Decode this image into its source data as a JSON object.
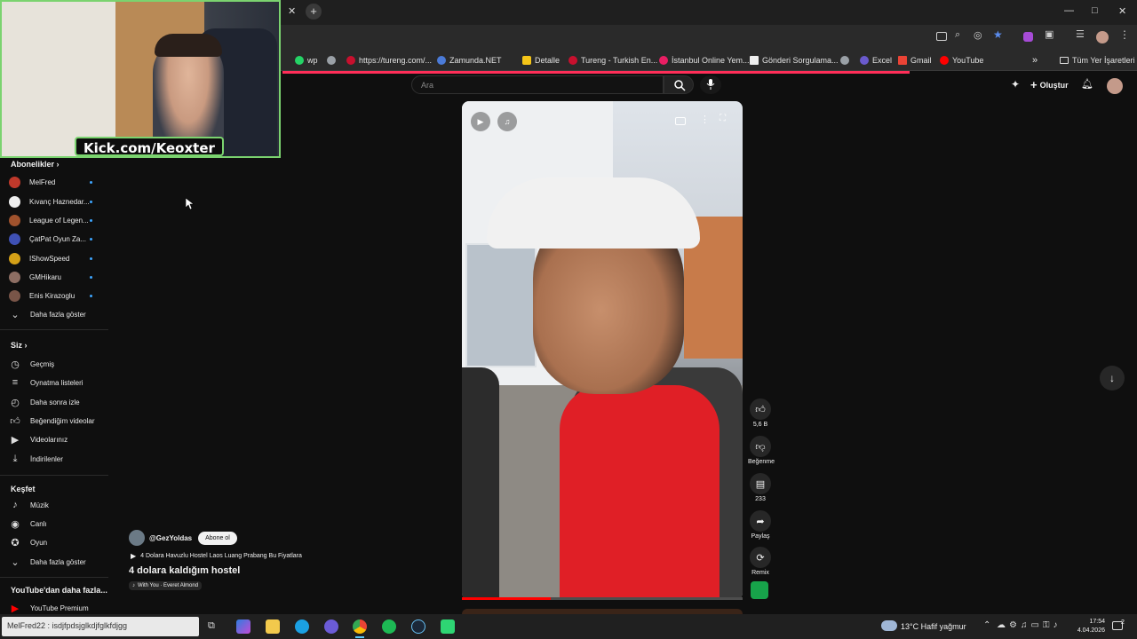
{
  "browser": {
    "window_controls": [
      "—",
      "□",
      "✕"
    ],
    "bookmarks": [
      {
        "label": "wp",
        "color": "#25d366"
      },
      {
        "label": "",
        "color": "#9aa0a6"
      },
      {
        "label": "https://tureng.com/...",
        "color": "#c8102e"
      },
      {
        "label": "Zamunda.NET",
        "color": "#4b7bd8"
      },
      {
        "label": "Detalle",
        "color": "#f5c518"
      },
      {
        "label": "Tureng - Turkish En...",
        "color": "#c8102e"
      },
      {
        "label": "İstanbul Online Yem...",
        "color": "#e91e63"
      },
      {
        "label": "Gönderi Sorgulama...",
        "color": "#eeeeee"
      },
      {
        "label": "",
        "color": "#9aa0a6"
      },
      {
        "label": "Excel",
        "color": "#6a5acd"
      },
      {
        "label": "Gmail",
        "color": "#ea4335"
      },
      {
        "label": "YouTube",
        "color": "#ff0000"
      }
    ],
    "more_bookmarks": "»",
    "all_bookmarks": "Tüm Yer İşaretleri"
  },
  "youtube": {
    "search_placeholder": "Ara",
    "create_label": "Oluştur"
  },
  "webcam": {
    "label": "Kick.com/Keoxter"
  },
  "sidebar": {
    "subscriptions_title": "Abonelikler",
    "subscriptions": [
      {
        "name": "MelFred",
        "color": "#c0392b"
      },
      {
        "name": "Kıvanç Haznedar...",
        "color": "#eeeeee"
      },
      {
        "name": "League of Legen...",
        "color": "#a0522d"
      },
      {
        "name": "ÇatPat Oyun Za...",
        "color": "#3f51b5"
      },
      {
        "name": "IShowSpeed",
        "color": "#d4a017"
      },
      {
        "name": "GMHikaru",
        "color": "#8d6e63"
      },
      {
        "name": "Enis Kirazoglu",
        "color": "#795548"
      }
    ],
    "show_more_1": "Daha fazla göster",
    "you_title": "Siz",
    "you_items": [
      "Geçmiş",
      "Oynatma listeleri",
      "Daha sonra izle",
      "Beğendiğim videolar",
      "Videolarınız",
      "İndirilenler"
    ],
    "explore_title": "Keşfet",
    "explore_items": [
      "Müzik",
      "Canlı",
      "Oyun"
    ],
    "show_more_2": "Daha fazla göster",
    "more_from_title": "YouTube'dan daha fazla...",
    "premium_label": "YouTube Premium"
  },
  "short": {
    "channel": "@GezYoldas",
    "subscribe_label": "Abone ol",
    "playlist_title": "4 Dolara Havuzlu Hostel Laos Luang Prabang Bu Fiyatlara",
    "title": "4 dolara kaldığım hostel",
    "music": "With You · Everet Almond",
    "likes": "5,6 B",
    "dislike_label": "Beğenme",
    "comments": "233",
    "share_label": "Paylaş",
    "remix_label": "Remix"
  },
  "taskbar": {
    "chat_text": "MelFred22 : isdjfpdsjglkdjfglkfdjgg",
    "weather": "13°C Hafif yağmur",
    "time": "17:54",
    "date": "4.04.2026",
    "notification_count": "2"
  }
}
